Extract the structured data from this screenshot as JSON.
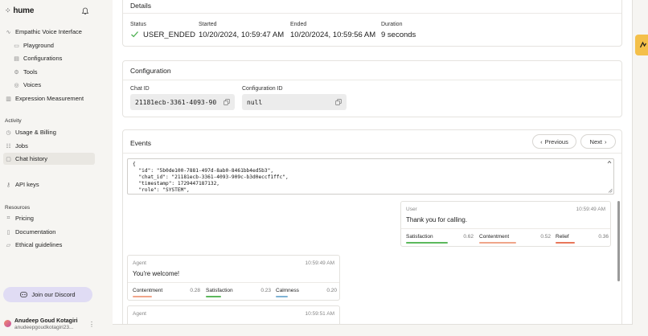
{
  "sidebar": {
    "brand": "hume",
    "nav": {
      "evi": "Empathic Voice Interface",
      "playground": "Playground",
      "configurations": "Configurations",
      "tools": "Tools",
      "voices": "Voices",
      "expression": "Expression Measurement"
    },
    "activity_label": "Activity",
    "activity": {
      "usage": "Usage & Billing",
      "jobs": "Jobs",
      "chat_history": "Chat history"
    },
    "api_keys": "API keys",
    "resources_label": "Resources",
    "resources": {
      "pricing": "Pricing",
      "documentation": "Documentation",
      "ethical": "Ethical guidelines"
    },
    "discord": "Join our Discord",
    "user": {
      "name": "Anudeep Goud Kotagiri",
      "email": "anudeepgoudkotagiri23..."
    }
  },
  "details": {
    "title": "Details",
    "status_label": "Status",
    "status": "USER_ENDED",
    "started_label": "Started",
    "started": "10/20/2024, 10:59:47 AM",
    "ended_label": "Ended",
    "ended": "10/20/2024, 10:59:56 AM",
    "duration_label": "Duration",
    "duration": "9 seconds"
  },
  "configuration": {
    "title": "Configuration",
    "chat_id_label": "Chat ID",
    "chat_id": "21181ecb-3361-4093-90",
    "config_id_label": "Configuration ID",
    "config_id": "null"
  },
  "events": {
    "title": "Events",
    "previous": "Previous",
    "next": "Next",
    "json_lines": [
      "{",
      "  \"id\": \"5b0de100-7881-497d-8ab0-8461bb4ed5b3\",",
      "  \"chat_id\": \"21181ecb-3361-4093-909c-b3d0eccf1ffc\",",
      "  \"timestamp\": 1729447187132,",
      "  \"role\": \"SYSTEM\","
    ],
    "messages": [
      {
        "role": "User",
        "time": "10:59:49 AM",
        "text": "Thank you for calling.",
        "emotions": [
          {
            "name": "Satisfaction",
            "value": "0.62",
            "score": 0.62,
            "color": "#5cb85c"
          },
          {
            "name": "Contentment",
            "value": "0.52",
            "score": 0.52,
            "color": "#f0a58a"
          },
          {
            "name": "Relief",
            "value": "0.36",
            "score": 0.36,
            "color": "#e8775a"
          }
        ]
      },
      {
        "role": "Agent",
        "time": "10:59:49 AM",
        "text": "You're welcome!",
        "emotions": [
          {
            "name": "Contentment",
            "value": "0.28",
            "score": 0.28,
            "color": "#f0a58a"
          },
          {
            "name": "Satisfaction",
            "value": "0.23",
            "score": 0.23,
            "color": "#5cb85c"
          },
          {
            "name": "Calmness",
            "value": "0.20",
            "score": 0.2,
            "color": "#7fb3d5"
          }
        ]
      },
      {
        "role": "Agent",
        "time": "10:59:51 AM"
      }
    ]
  }
}
